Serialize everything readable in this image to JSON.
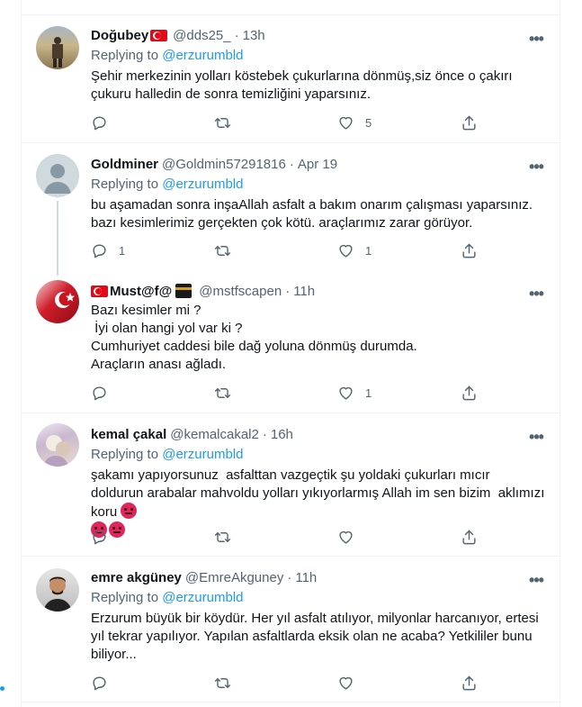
{
  "tweets": [
    {
      "name": "Doğubey",
      "flag": true,
      "handle": "@dds25_",
      "time": "13h",
      "replying_label": "Replying to",
      "replying_to": "@erzurumbld",
      "text": "Şehir merkezinin yolları köstebek çukurlarına dönmüş,siz önce o çakırı çukuru halledin de sonra temizliğini yaparsınız.",
      "reply_count": "",
      "retweet_count": "",
      "like_count": "5"
    },
    {
      "name": "Goldminer",
      "handle": "@Goldmin57291816",
      "time": "Apr 19",
      "replying_label": "Replying to",
      "replying_to": "@erzurumbld",
      "text": "bu aşamadan sonra inşaAllah asfalt a bakım onarım çalışması yaparsınız. bazı kesimlerimiz gerçekten çok kötü. araçlarımız zarar görüyor.",
      "reply_count": "1",
      "retweet_count": "",
      "like_count": "1"
    },
    {
      "name": "Must@f@",
      "handle": "@mstfscapen",
      "time": "11h",
      "text": "Bazı kesimler mi ?\n İyi olan hangi yol var ki ?\nCumhuriyet caddesi bile dağ yoluna dönmüş durumda.\nAraçların anası ağladı.",
      "reply_count": "",
      "retweet_count": "",
      "like_count": "1"
    },
    {
      "name": "kemal çakal",
      "handle": "@kemalcakal2",
      "time": "16h",
      "replying_label": "Replying to",
      "replying_to": "@erzurumbld",
      "text": "şakamı yapıyorsunuz  asfalttan vazgeçtik şu yoldaki çukurları mıcır doldurun arabalar mahvoldu yolları yıkıyorlarmış Allah im sen bizim  aklımızı koru ",
      "reply_count": "",
      "retweet_count": "",
      "like_count": ""
    },
    {
      "name": "emre akgüney",
      "handle": "@EmreAkguney",
      "time": "11h",
      "replying_label": "Replying to",
      "replying_to": "@erzurumbld",
      "text": "Erzurum büyük bir köydür. Her yıl asfalt atılıyor, milyonlar harcanıyor, ertesi yıl tekrar yapılıyor. Yapılan asfaltlarda eksik olan ne acaba? Yetkililer bunu biliyor...",
      "reply_count": "",
      "retweet_count": "",
      "like_count": ""
    }
  ],
  "dot_separator": "·",
  "more_label": "•••",
  "colors": {
    "accent": "#1d9bf0",
    "secondary_text": "#536471",
    "divider": "#eff3f4"
  }
}
